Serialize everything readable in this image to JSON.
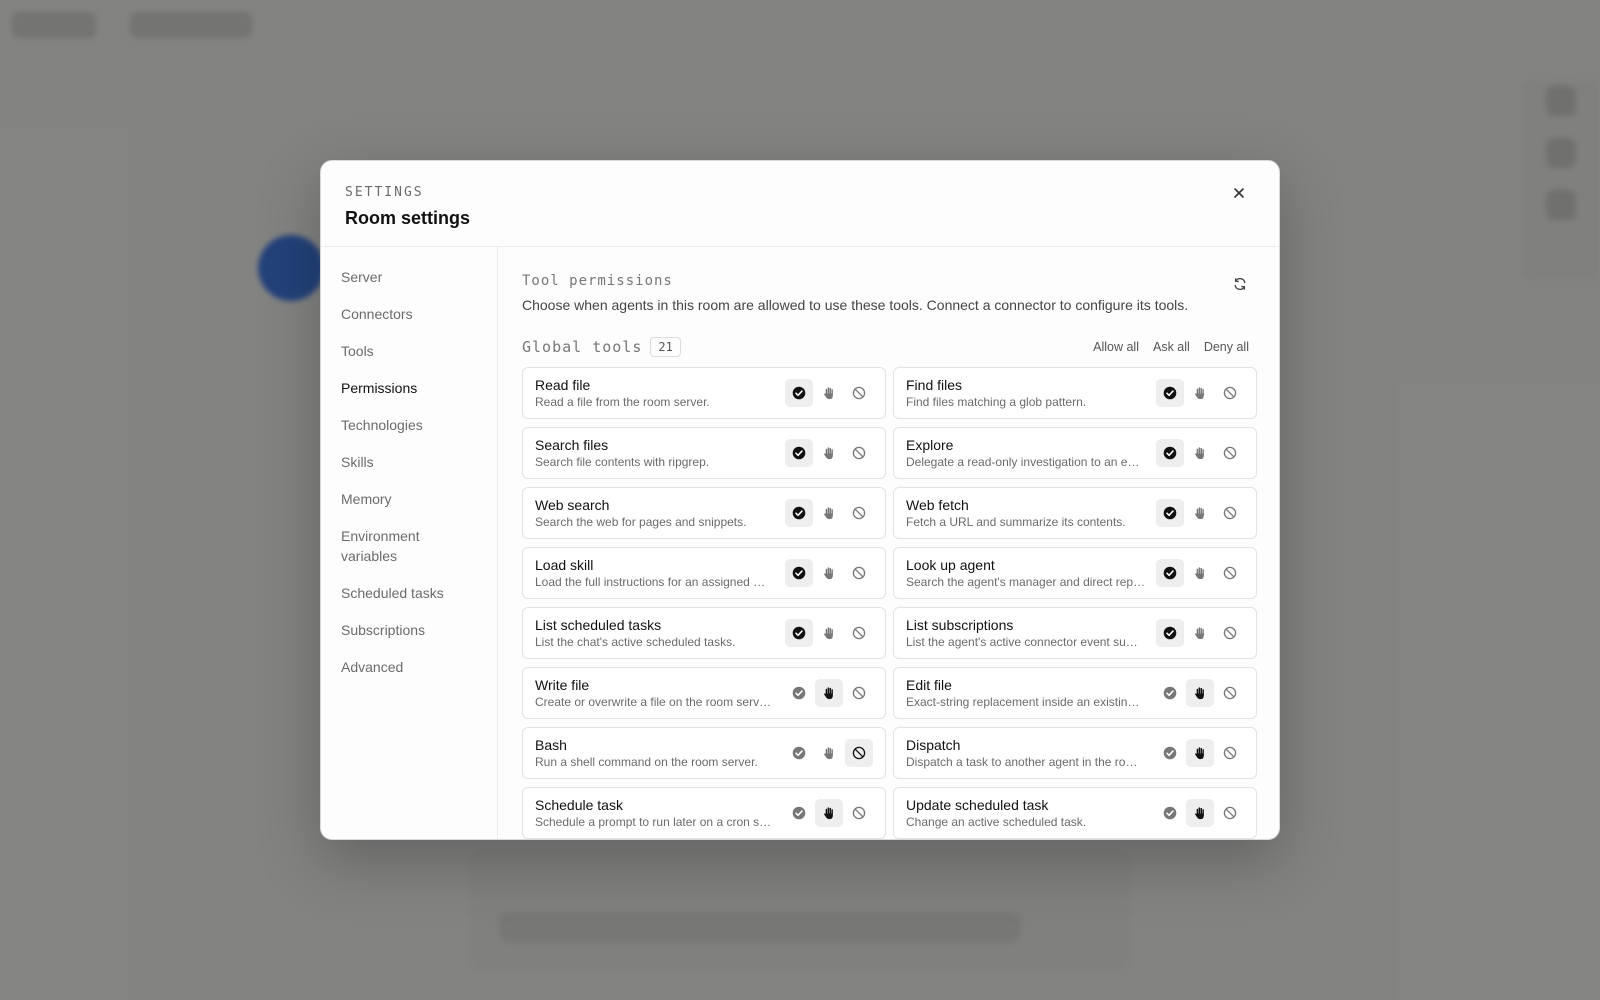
{
  "header": {
    "eyebrow": "SETTINGS",
    "title": "Room settings"
  },
  "sidebar": {
    "items": [
      {
        "label": "Server",
        "active": false
      },
      {
        "label": "Connectors",
        "active": false
      },
      {
        "label": "Tools",
        "active": false
      },
      {
        "label": "Permissions",
        "active": true
      },
      {
        "label": "Technologies",
        "active": false
      },
      {
        "label": "Skills",
        "active": false
      },
      {
        "label": "Memory",
        "active": false
      },
      {
        "label": "Environment variables",
        "active": false
      },
      {
        "label": "Scheduled tasks",
        "active": false
      },
      {
        "label": "Subscriptions",
        "active": false
      },
      {
        "label": "Advanced",
        "active": false
      }
    ]
  },
  "permissions": {
    "title": "Tool permissions",
    "description": "Choose when agents in this room are allowed to use these tools. Connect a connector to configure its tools.",
    "group": {
      "title": "Global tools",
      "count": "21",
      "allow_all": "Allow all",
      "ask_all": "Ask all",
      "deny_all": "Deny all"
    },
    "tools": [
      {
        "name": "Read file",
        "desc": "Read a file from the room server.",
        "state": "allow"
      },
      {
        "name": "Find files",
        "desc": "Find files matching a glob pattern.",
        "state": "allow"
      },
      {
        "name": "Search files",
        "desc": "Search file contents with ripgrep.",
        "state": "allow"
      },
      {
        "name": "Explore",
        "desc": "Delegate a read-only investigation to an e…",
        "state": "allow"
      },
      {
        "name": "Web search",
        "desc": "Search the web for pages and snippets.",
        "state": "allow"
      },
      {
        "name": "Web fetch",
        "desc": "Fetch a URL and summarize its contents.",
        "state": "allow"
      },
      {
        "name": "Load skill",
        "desc": "Load the full instructions for an assigned …",
        "state": "allow"
      },
      {
        "name": "Look up agent",
        "desc": "Search the agent's manager and direct rep…",
        "state": "allow"
      },
      {
        "name": "List scheduled tasks",
        "desc": "List the chat's active scheduled tasks.",
        "state": "allow"
      },
      {
        "name": "List subscriptions",
        "desc": "List the agent's active connector event su…",
        "state": "allow"
      },
      {
        "name": "Write file",
        "desc": "Create or overwrite a file on the room serv…",
        "state": "ask"
      },
      {
        "name": "Edit file",
        "desc": "Exact-string replacement inside an existin…",
        "state": "ask"
      },
      {
        "name": "Bash",
        "desc": "Run a shell command on the room server.",
        "state": "deny"
      },
      {
        "name": "Dispatch",
        "desc": "Dispatch a task to another agent in the ro…",
        "state": "ask"
      },
      {
        "name": "Schedule task",
        "desc": "Schedule a prompt to run later on a cron s…",
        "state": "ask"
      },
      {
        "name": "Update scheduled task",
        "desc": "Change an active scheduled task.",
        "state": "ask"
      }
    ]
  },
  "icons": {
    "close": "close-icon",
    "refresh": "refresh-icon",
    "allow": "check-circle-icon",
    "ask": "hand-icon",
    "deny": "ban-icon"
  }
}
